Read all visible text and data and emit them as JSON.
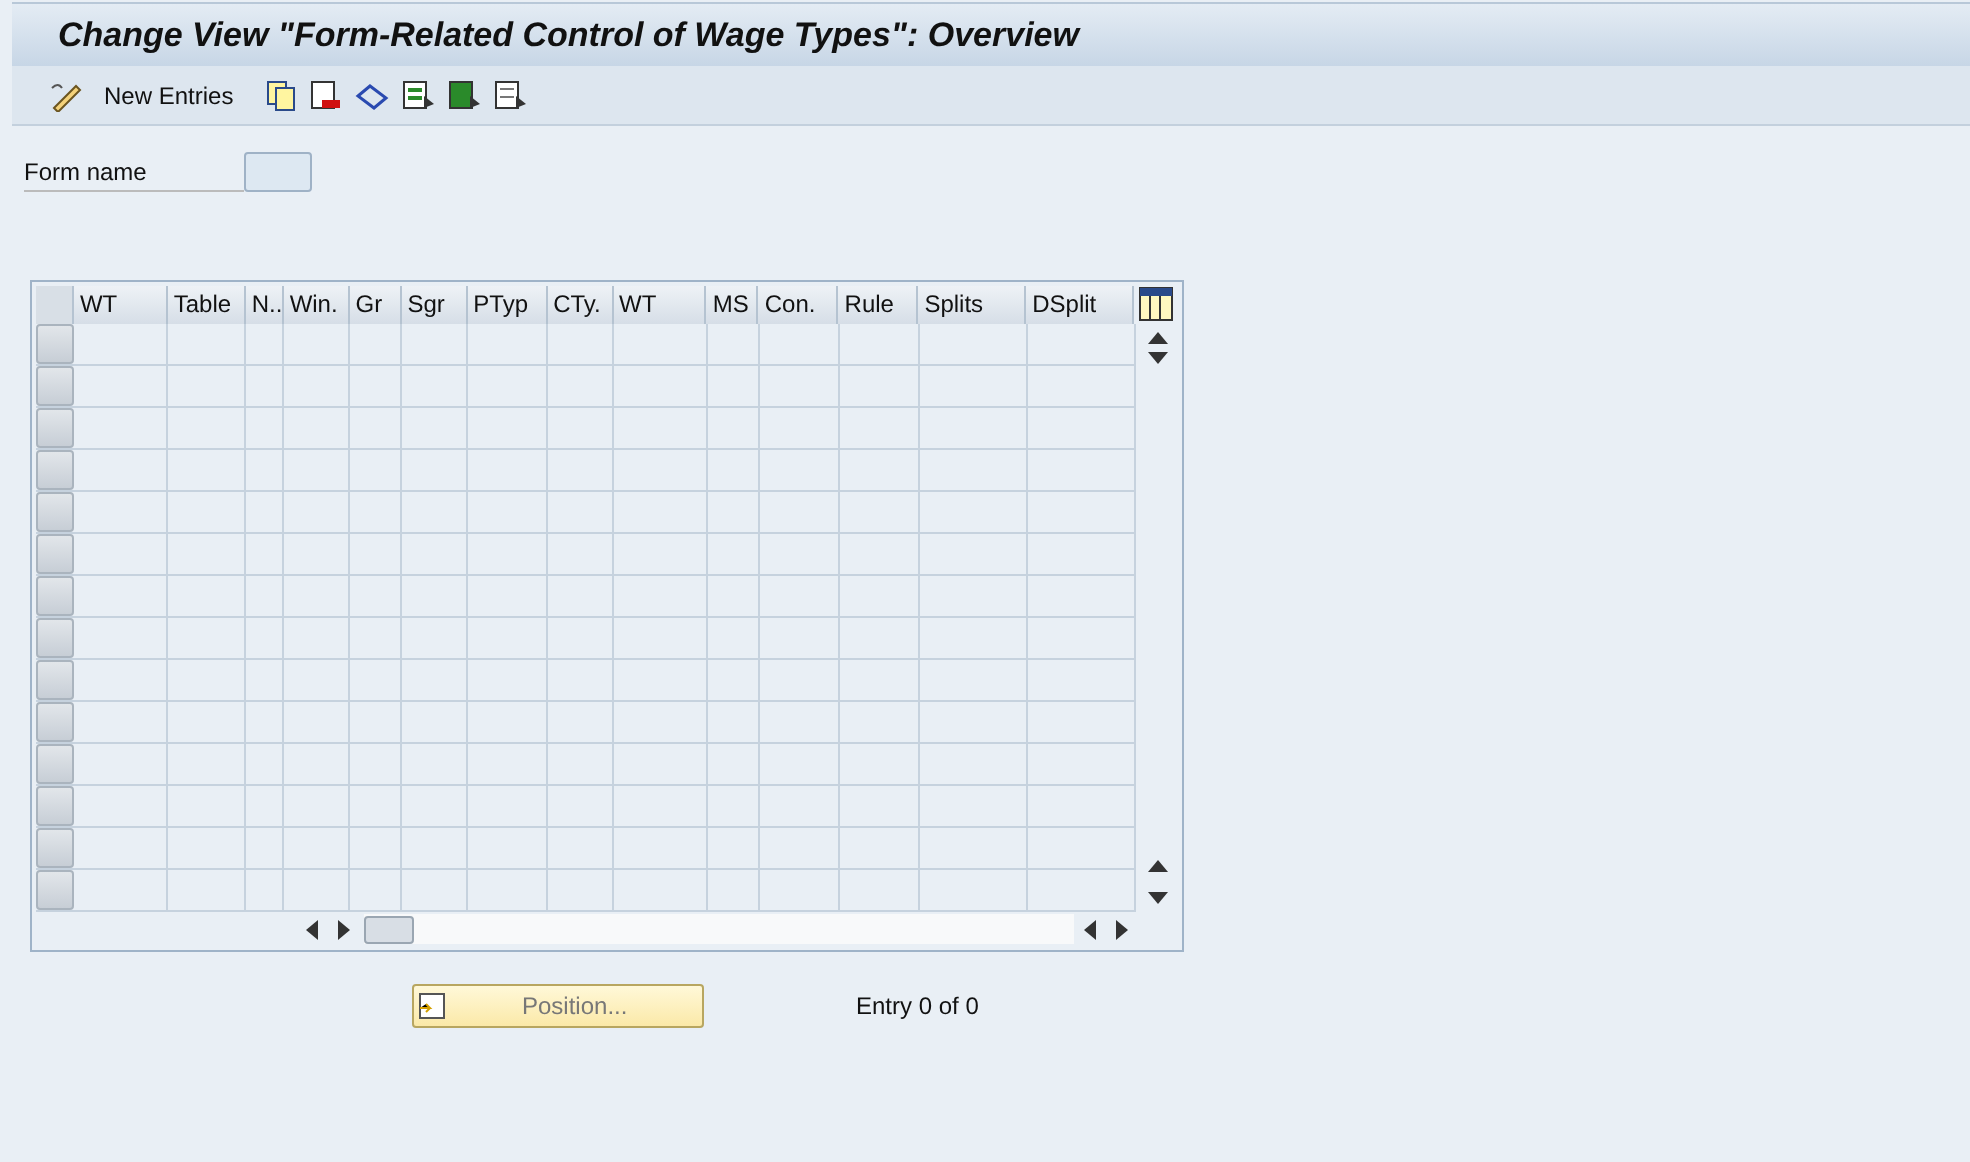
{
  "window": {
    "title": "Change View \"Form-Related Control of Wage Types\": Overview"
  },
  "toolbar": {
    "new_entries": "New Entries"
  },
  "form": {
    "label": "Form name"
  },
  "table": {
    "columns": [
      "WT",
      "Table",
      "N..",
      "Win.",
      "Gr",
      "Sgr",
      "PTyp",
      "CTy.",
      "WT",
      "MS",
      "Con.",
      "Rule",
      "Splits",
      "DSplit"
    ]
  },
  "position_button": "Position...",
  "entry_count": "Entry 0 of 0"
}
